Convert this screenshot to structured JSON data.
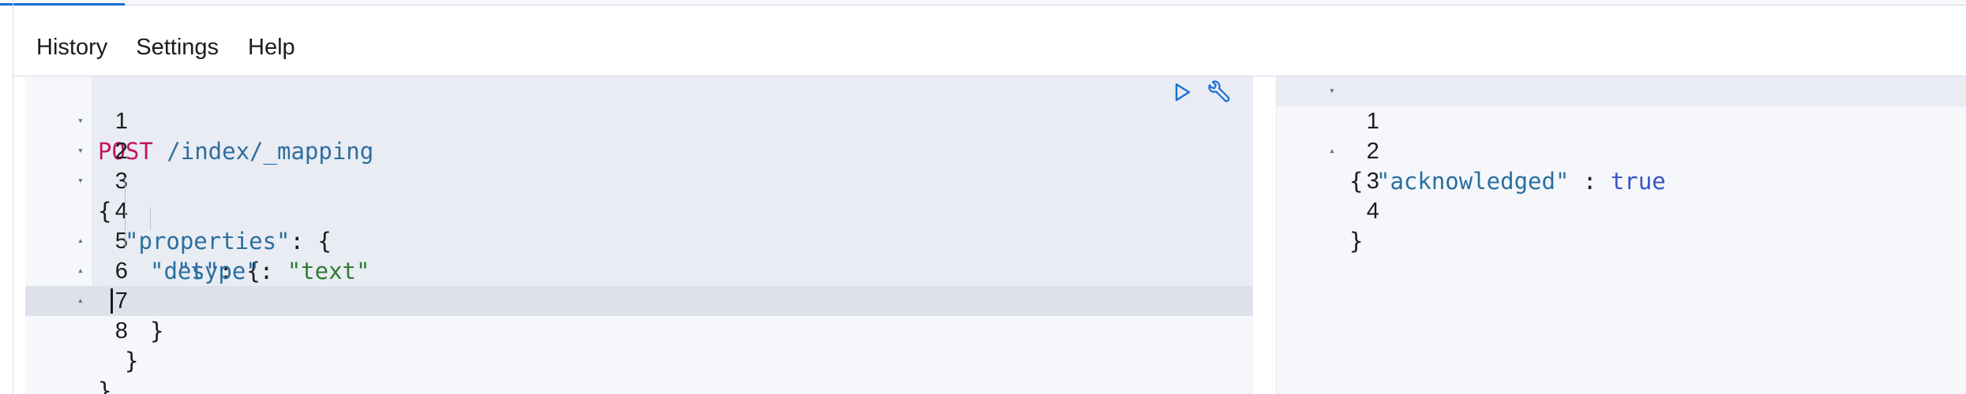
{
  "menu": {
    "items": [
      {
        "label": "History"
      },
      {
        "label": "Settings"
      },
      {
        "label": "Help"
      }
    ]
  },
  "request": {
    "line_numbers": [
      "1",
      "2",
      "3",
      "4",
      "5",
      "6",
      "7",
      "8"
    ],
    "lines": [
      {
        "method": "POST",
        "path": " /index/_mapping"
      },
      {
        "text": "{"
      },
      {
        "key": "\"properties\"",
        "rest": ": {"
      },
      {
        "key": "\"des\"",
        "rest": ": {"
      },
      {
        "key": "\"type\"",
        "sep": ": ",
        "value": "\"text\""
      },
      {
        "text": "}"
      },
      {
        "text": "}"
      },
      {
        "text": "}"
      }
    ],
    "icons": [
      "play-icon",
      "wrench-icon"
    ]
  },
  "response": {
    "line_numbers": [
      "1",
      "2",
      "3",
      "4"
    ],
    "lines": [
      {
        "text": "{"
      },
      {
        "key": "\"acknowledged\"",
        "sep": " : ",
        "value": "true"
      },
      {
        "text": "}"
      },
      {
        "text": ""
      }
    ]
  },
  "colors": {
    "method": "#c2185b",
    "key": "#2a6fa0",
    "string": "#2e7d32",
    "boolean": "#3a54c8",
    "tab_indicator": "#1a6ed8"
  }
}
